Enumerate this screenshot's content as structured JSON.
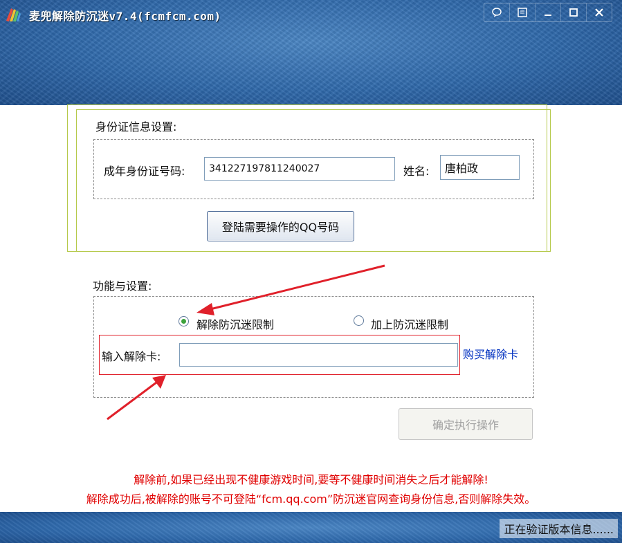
{
  "window": {
    "title": "麦兜解除防沉迷v7.4(fcmfcm.com)",
    "buttons": [
      "◌",
      "▤",
      "—",
      "☐",
      "✕"
    ]
  },
  "id_section": {
    "heading": "身份证信息设置:",
    "id_label": "成年身份证号码:",
    "id_value": "341227197811240027",
    "name_label": "姓名:",
    "name_value": "唐柏政",
    "login_button": "登陆需要操作的QQ号码"
  },
  "function_section": {
    "heading": "功能与设置:",
    "radio_remove": "解除防沉迷限制",
    "radio_add": "加上防沉迷限制",
    "selected": "remove",
    "card_label": "输入解除卡:",
    "card_value": "",
    "buy_link": "购买解除卡",
    "execute_button": "确定执行操作"
  },
  "notes": [
    "解除前,如果已经出现不健康游戏时间,要等不健康时间消失之后才能解除!",
    "解除成功后,被解除的账号不可登陆“fcm.qq.com”防沉迷官网查询身份信息,否则解除失效。"
  ],
  "status_text": "正在验证版本信息......",
  "colors": {
    "frame_blue": "#2f69ab",
    "warning_red": "#e00000",
    "link_blue": "#0030c0",
    "radio_green": "#3da33d"
  }
}
